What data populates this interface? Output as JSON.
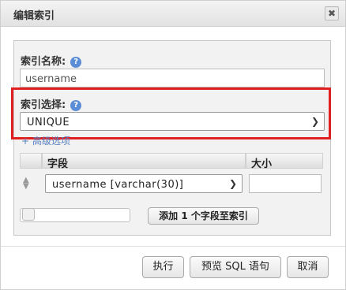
{
  "dialog": {
    "title": "编辑索引",
    "close_glyph": "✖"
  },
  "index_name": {
    "label": "索引名称:",
    "value": "username"
  },
  "index_choice": {
    "label": "索引选择:",
    "selected": "UNIQUE"
  },
  "advanced_link": "+ 高级选项",
  "columns_table": {
    "headers": [
      "字段",
      "大小"
    ],
    "rows": [
      {
        "field": "username [varchar(30)]",
        "size": ""
      }
    ]
  },
  "add_fields_button": "添加 1 个字段至索引",
  "footer": {
    "execute": "执行",
    "preview_sql": "预览 SQL 语句",
    "cancel": "取消"
  },
  "colors": {
    "highlight": "#e02020",
    "help_icon": "#5b8dd6",
    "link": "#5a7fbf"
  }
}
